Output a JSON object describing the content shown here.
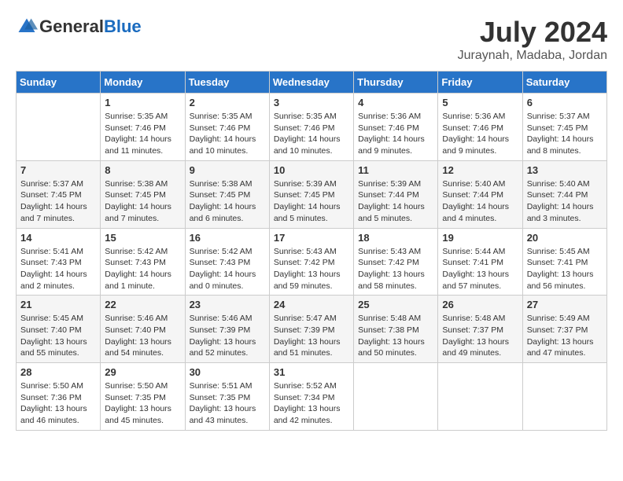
{
  "header": {
    "logo_general": "General",
    "logo_blue": "Blue",
    "month_title": "July 2024",
    "location": "Juraynah, Madaba, Jordan"
  },
  "weekdays": [
    "Sunday",
    "Monday",
    "Tuesday",
    "Wednesday",
    "Thursday",
    "Friday",
    "Saturday"
  ],
  "weeks": [
    [
      {
        "day": "",
        "info": ""
      },
      {
        "day": "1",
        "info": "Sunrise: 5:35 AM\nSunset: 7:46 PM\nDaylight: 14 hours\nand 11 minutes."
      },
      {
        "day": "2",
        "info": "Sunrise: 5:35 AM\nSunset: 7:46 PM\nDaylight: 14 hours\nand 10 minutes."
      },
      {
        "day": "3",
        "info": "Sunrise: 5:35 AM\nSunset: 7:46 PM\nDaylight: 14 hours\nand 10 minutes."
      },
      {
        "day": "4",
        "info": "Sunrise: 5:36 AM\nSunset: 7:46 PM\nDaylight: 14 hours\nand 9 minutes."
      },
      {
        "day": "5",
        "info": "Sunrise: 5:36 AM\nSunset: 7:46 PM\nDaylight: 14 hours\nand 9 minutes."
      },
      {
        "day": "6",
        "info": "Sunrise: 5:37 AM\nSunset: 7:45 PM\nDaylight: 14 hours\nand 8 minutes."
      }
    ],
    [
      {
        "day": "7",
        "info": "Sunrise: 5:37 AM\nSunset: 7:45 PM\nDaylight: 14 hours\nand 7 minutes."
      },
      {
        "day": "8",
        "info": "Sunrise: 5:38 AM\nSunset: 7:45 PM\nDaylight: 14 hours\nand 7 minutes."
      },
      {
        "day": "9",
        "info": "Sunrise: 5:38 AM\nSunset: 7:45 PM\nDaylight: 14 hours\nand 6 minutes."
      },
      {
        "day": "10",
        "info": "Sunrise: 5:39 AM\nSunset: 7:45 PM\nDaylight: 14 hours\nand 5 minutes."
      },
      {
        "day": "11",
        "info": "Sunrise: 5:39 AM\nSunset: 7:44 PM\nDaylight: 14 hours\nand 5 minutes."
      },
      {
        "day": "12",
        "info": "Sunrise: 5:40 AM\nSunset: 7:44 PM\nDaylight: 14 hours\nand 4 minutes."
      },
      {
        "day": "13",
        "info": "Sunrise: 5:40 AM\nSunset: 7:44 PM\nDaylight: 14 hours\nand 3 minutes."
      }
    ],
    [
      {
        "day": "14",
        "info": "Sunrise: 5:41 AM\nSunset: 7:43 PM\nDaylight: 14 hours\nand 2 minutes."
      },
      {
        "day": "15",
        "info": "Sunrise: 5:42 AM\nSunset: 7:43 PM\nDaylight: 14 hours\nand 1 minute."
      },
      {
        "day": "16",
        "info": "Sunrise: 5:42 AM\nSunset: 7:43 PM\nDaylight: 14 hours\nand 0 minutes."
      },
      {
        "day": "17",
        "info": "Sunrise: 5:43 AM\nSunset: 7:42 PM\nDaylight: 13 hours\nand 59 minutes."
      },
      {
        "day": "18",
        "info": "Sunrise: 5:43 AM\nSunset: 7:42 PM\nDaylight: 13 hours\nand 58 minutes."
      },
      {
        "day": "19",
        "info": "Sunrise: 5:44 AM\nSunset: 7:41 PM\nDaylight: 13 hours\nand 57 minutes."
      },
      {
        "day": "20",
        "info": "Sunrise: 5:45 AM\nSunset: 7:41 PM\nDaylight: 13 hours\nand 56 minutes."
      }
    ],
    [
      {
        "day": "21",
        "info": "Sunrise: 5:45 AM\nSunset: 7:40 PM\nDaylight: 13 hours\nand 55 minutes."
      },
      {
        "day": "22",
        "info": "Sunrise: 5:46 AM\nSunset: 7:40 PM\nDaylight: 13 hours\nand 54 minutes."
      },
      {
        "day": "23",
        "info": "Sunrise: 5:46 AM\nSunset: 7:39 PM\nDaylight: 13 hours\nand 52 minutes."
      },
      {
        "day": "24",
        "info": "Sunrise: 5:47 AM\nSunset: 7:39 PM\nDaylight: 13 hours\nand 51 minutes."
      },
      {
        "day": "25",
        "info": "Sunrise: 5:48 AM\nSunset: 7:38 PM\nDaylight: 13 hours\nand 50 minutes."
      },
      {
        "day": "26",
        "info": "Sunrise: 5:48 AM\nSunset: 7:37 PM\nDaylight: 13 hours\nand 49 minutes."
      },
      {
        "day": "27",
        "info": "Sunrise: 5:49 AM\nSunset: 7:37 PM\nDaylight: 13 hours\nand 47 minutes."
      }
    ],
    [
      {
        "day": "28",
        "info": "Sunrise: 5:50 AM\nSunset: 7:36 PM\nDaylight: 13 hours\nand 46 minutes."
      },
      {
        "day": "29",
        "info": "Sunrise: 5:50 AM\nSunset: 7:35 PM\nDaylight: 13 hours\nand 45 minutes."
      },
      {
        "day": "30",
        "info": "Sunrise: 5:51 AM\nSunset: 7:35 PM\nDaylight: 13 hours\nand 43 minutes."
      },
      {
        "day": "31",
        "info": "Sunrise: 5:52 AM\nSunset: 7:34 PM\nDaylight: 13 hours\nand 42 minutes."
      },
      {
        "day": "",
        "info": ""
      },
      {
        "day": "",
        "info": ""
      },
      {
        "day": "",
        "info": ""
      }
    ]
  ]
}
